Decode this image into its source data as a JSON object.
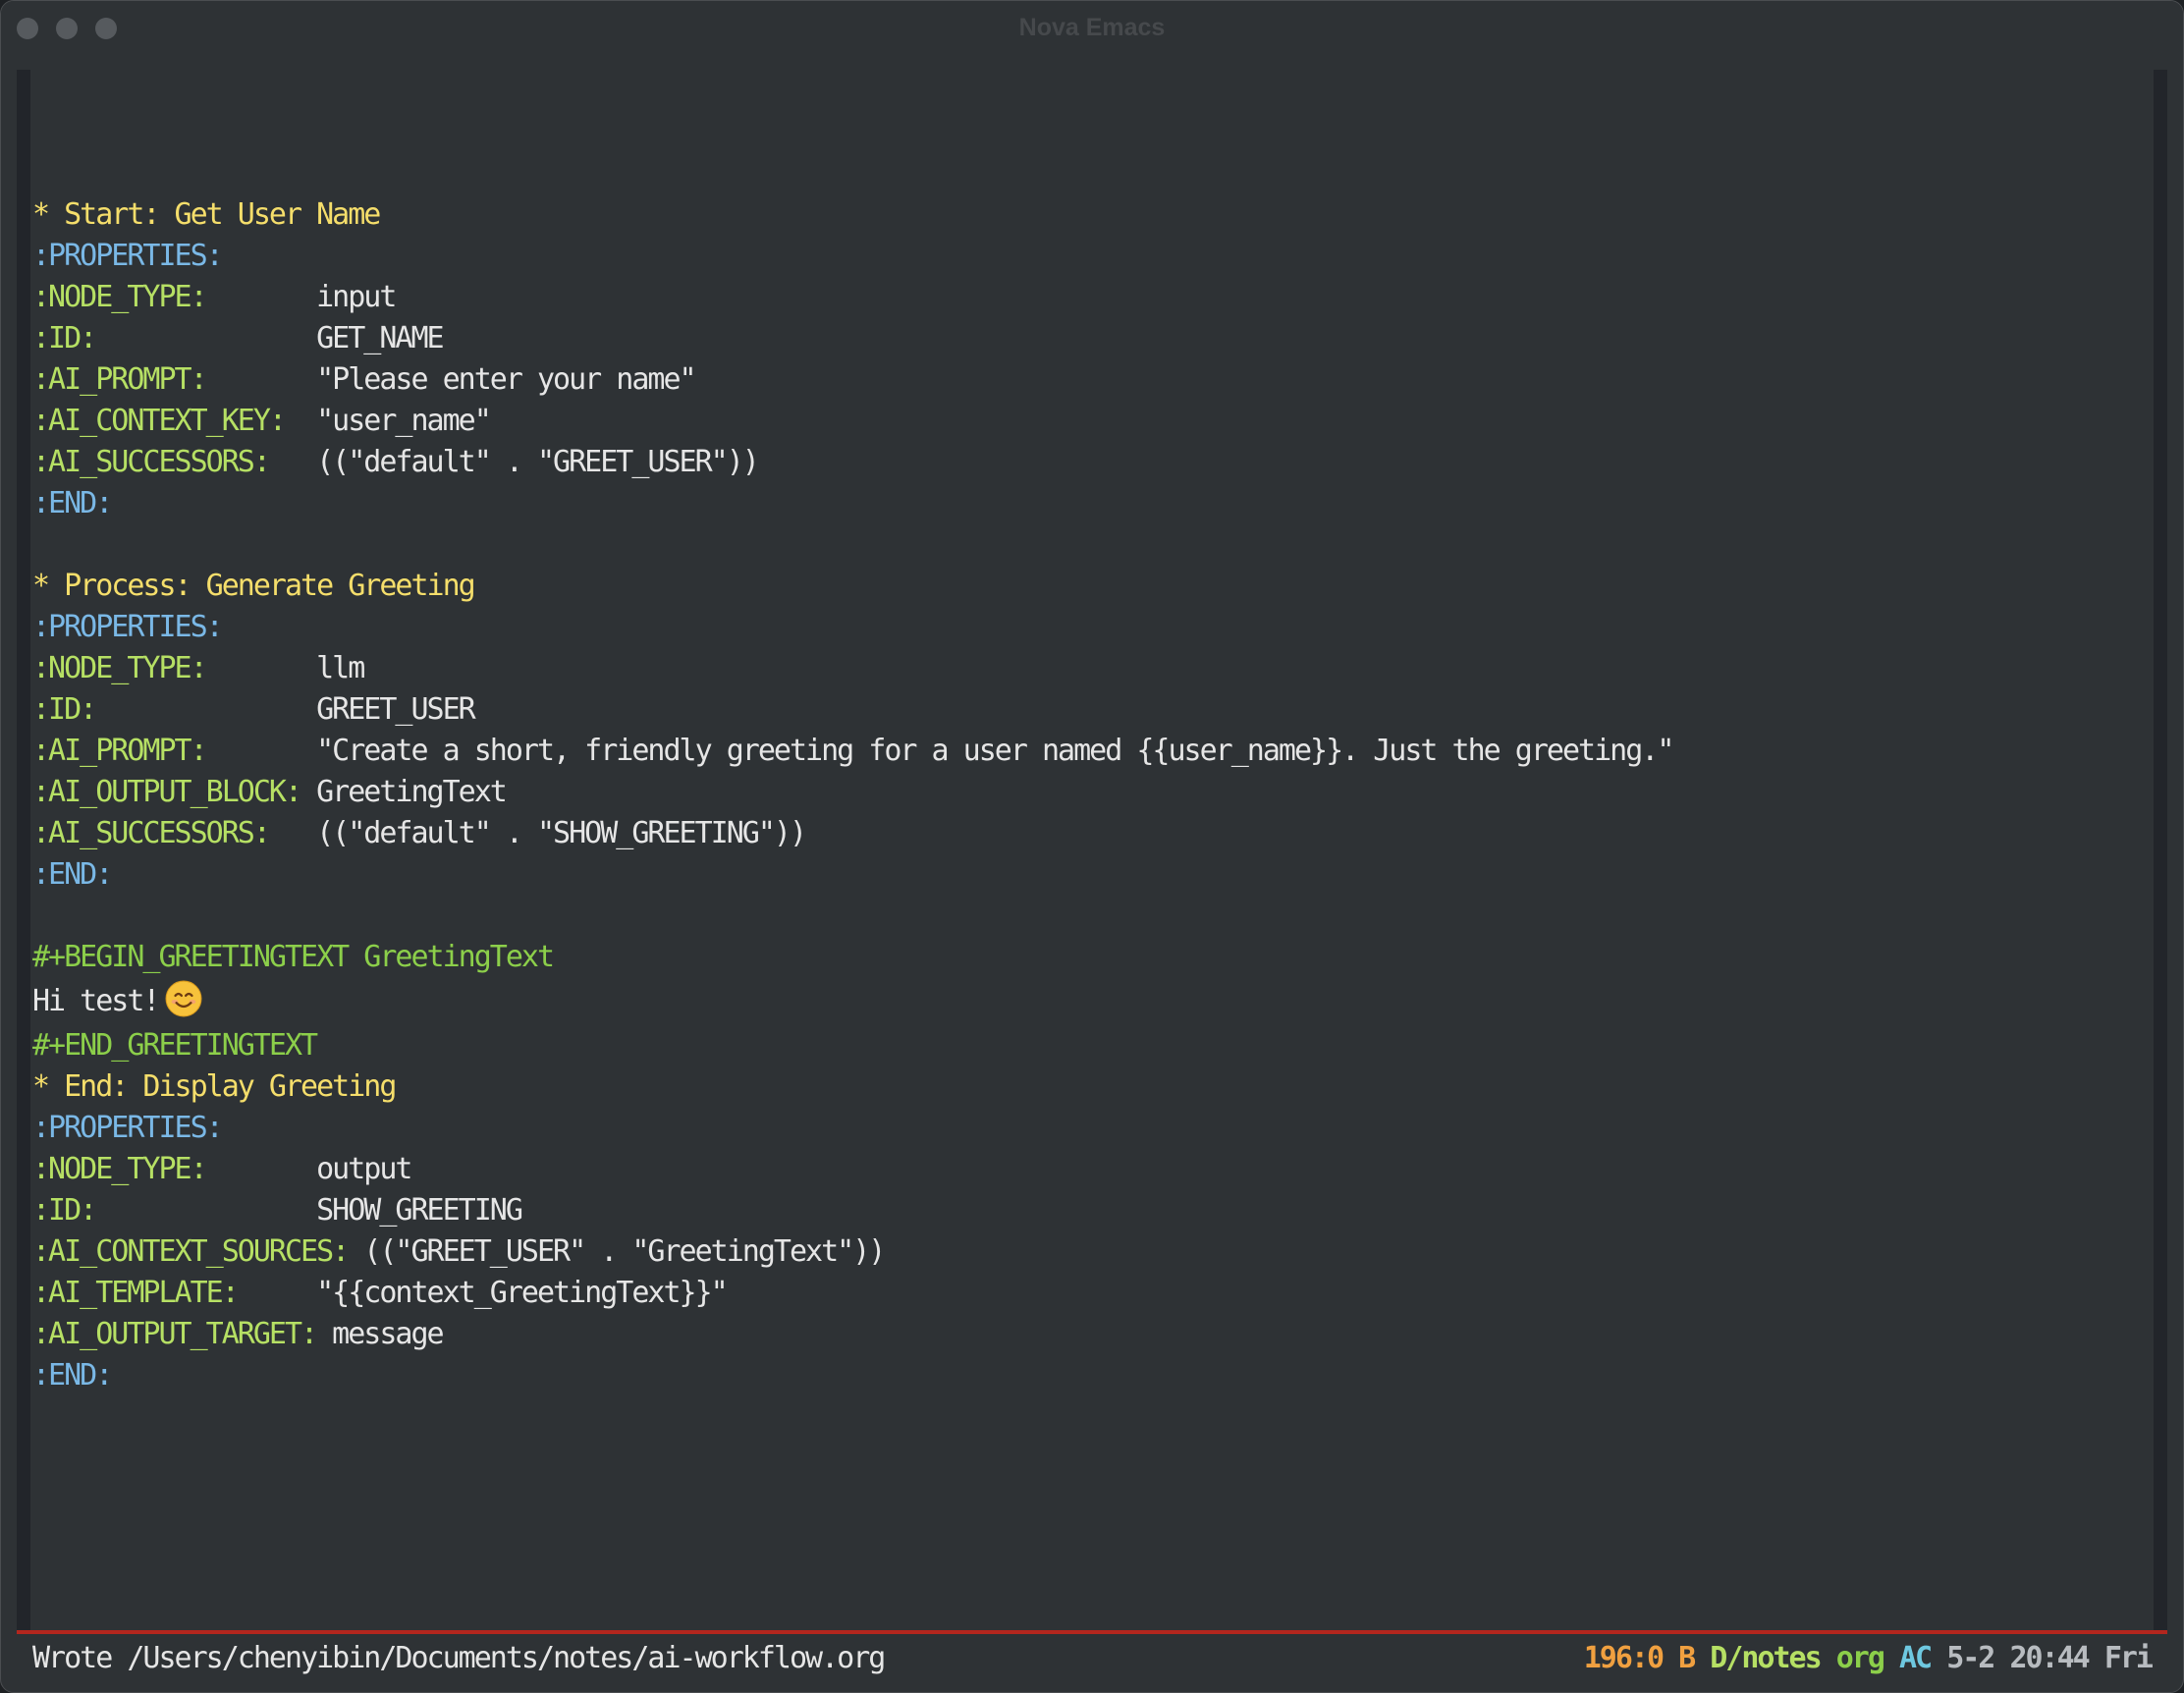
{
  "window": {
    "title": "Nova Emacs"
  },
  "buffer": {
    "lines": [
      {
        "kind": "heading",
        "text": "* Start: Get User Name"
      },
      {
        "kind": "drawer",
        "text": ":PROPERTIES:"
      },
      {
        "kind": "prop",
        "key": ":NODE_TYPE:",
        "pad": "       ",
        "value": "input"
      },
      {
        "kind": "prop",
        "key": ":ID:",
        "pad": "              ",
        "value": "GET_NAME"
      },
      {
        "kind": "prop",
        "key": ":AI_PROMPT:",
        "pad": "       ",
        "value": "\"Please enter your name\""
      },
      {
        "kind": "prop",
        "key": ":AI_CONTEXT_KEY:",
        "pad": "  ",
        "value": "\"user_name\""
      },
      {
        "kind": "prop",
        "key": ":AI_SUCCESSORS:",
        "pad": "   ",
        "value": "((\"default\" . \"GREET_USER\"))"
      },
      {
        "kind": "drawer",
        "text": ":END:"
      },
      {
        "kind": "blank",
        "text": ""
      },
      {
        "kind": "heading",
        "text": "* Process: Generate Greeting"
      },
      {
        "kind": "drawer",
        "text": ":PROPERTIES:"
      },
      {
        "kind": "prop",
        "key": ":NODE_TYPE:",
        "pad": "       ",
        "value": "llm"
      },
      {
        "kind": "prop",
        "key": ":ID:",
        "pad": "              ",
        "value": "GREET_USER"
      },
      {
        "kind": "prop",
        "key": ":AI_PROMPT:",
        "pad": "       ",
        "value": "\"Create a short, friendly greeting for a user named {{user_name}}. Just the greeting.\""
      },
      {
        "kind": "prop",
        "key": ":AI_OUTPUT_BLOCK:",
        "pad": " ",
        "value": "GreetingText"
      },
      {
        "kind": "prop",
        "key": ":AI_SUCCESSORS:",
        "pad": "   ",
        "value": "((\"default\" . \"SHOW_GREETING\"))"
      },
      {
        "kind": "drawer",
        "text": ":END:"
      },
      {
        "kind": "blank",
        "text": ""
      },
      {
        "kind": "block",
        "text": "#+BEGIN_GREETINGTEXT GreetingText"
      },
      {
        "kind": "text-emoji",
        "text": "Hi test!",
        "emoji": "smiling-face"
      },
      {
        "kind": "block",
        "text": "#+END_GREETINGTEXT"
      },
      {
        "kind": "heading",
        "text": "* End: Display Greeting"
      },
      {
        "kind": "drawer",
        "text": ":PROPERTIES:"
      },
      {
        "kind": "prop",
        "key": ":NODE_TYPE:",
        "pad": "       ",
        "value": "output"
      },
      {
        "kind": "prop",
        "key": ":ID:",
        "pad": "              ",
        "value": "SHOW_GREETING"
      },
      {
        "kind": "prop",
        "key": ":AI_CONTEXT_SOURCES:",
        "pad": " ",
        "value": "((\"GREET_USER\" . \"GreetingText\"))"
      },
      {
        "kind": "prop",
        "key": ":AI_TEMPLATE:",
        "pad": "     ",
        "value": "\"{{context_GreetingText}}\""
      },
      {
        "kind": "prop",
        "key": ":AI_OUTPUT_TARGET:",
        "pad": " ",
        "value": "message"
      },
      {
        "kind": "drawer",
        "text": ":END:"
      }
    ]
  },
  "minibuffer": {
    "message": "Wrote /Users/chenyibin/Documents/notes/ai-workflow.org"
  },
  "modeline": {
    "position": "196:0",
    "buffer_flag": "B",
    "directory": "D/notes",
    "major_mode": "org",
    "minor_mode": "AC",
    "date": "5-2",
    "time": "20:44",
    "weekday": "Fri"
  },
  "colors": {
    "heading": "#f5de6b",
    "drawer": "#7ab8e6",
    "property_key": "#b6e064",
    "block_delimiter": "#8ccf4a",
    "modeline_separator": "#b3261e",
    "background": "#2e3235"
  }
}
